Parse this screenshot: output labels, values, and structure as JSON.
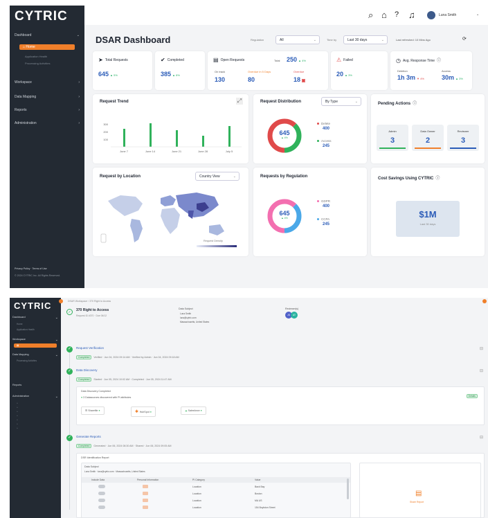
{
  "app": {
    "logo": "CYTRIC",
    "accent": "#f07f2a",
    "primary": "#2b5cb8",
    "success": "#30b25b"
  },
  "topbar": {
    "user_name": "Luna Smith",
    "icons": [
      "search-icon",
      "home-icon",
      "help-icon",
      "bell-icon"
    ]
  },
  "sidebar": {
    "items": [
      {
        "label": "Dashboard",
        "active_child": "Home",
        "children": [
          "Application Health",
          "Processing Activities"
        ]
      },
      {
        "label": "Workspace"
      },
      {
        "label": "Data Mapping"
      },
      {
        "label": "Reports"
      },
      {
        "label": "Administration"
      }
    ],
    "footer_links": "Privacy Policy  ·  Terms of Use",
    "copyright": "© 2024 CYTRIC Inc. All Rights Reserved."
  },
  "dashboard": {
    "title": "DSAR Dashboard",
    "filters": {
      "regulation_label": "Regulation",
      "regulation_value": "All",
      "timeby_label": "Time by",
      "timeby_value": "Last 30 days",
      "refresh_text": "Last refreshed: 10 Mins Ago"
    },
    "kpis": [
      {
        "title": "Total Requests",
        "value": "645",
        "delta": "▲ 5%",
        "icon": "send-icon"
      },
      {
        "title": "Completed",
        "value": "385",
        "delta": "▲ 8%",
        "icon": "check-badge-icon"
      },
      {
        "title": "Open Requests",
        "total_label": "Total",
        "total_value": "250",
        "delta": "▲ 4%",
        "icon": "document-icon",
        "subs": [
          {
            "label": "On track",
            "value": "130"
          },
          {
            "label": "Overdue in 5 Days",
            "value": "80"
          },
          {
            "label": "Overdue",
            "value": "18"
          }
        ]
      },
      {
        "title": "Failed",
        "value": "20",
        "delta": "▲ 3%",
        "icon": "warning-icon"
      },
      {
        "title": "Avg. Response Time",
        "icon": "clock-icon",
        "subs": [
          {
            "label": "Deletion",
            "value": "1h 3m",
            "delta": "▼ 4%"
          },
          {
            "label": "Access",
            "value": "30m",
            "delta": "▲ 3%"
          }
        ]
      }
    ],
    "request_trend": {
      "title": "Request Trend",
      "y_ticks": [
        "300",
        "200",
        "100"
      ],
      "x_labels": [
        "June 7",
        "June 14",
        "June 21",
        "June 28",
        "July 5"
      ]
    },
    "distribution": {
      "title": "Request Distribution",
      "select": "By Type",
      "center_value": "645",
      "center_delta": "▲ 4%",
      "legend": [
        {
          "label": "Delete",
          "value": "400",
          "color": "#e04a4a"
        },
        {
          "label": "Access",
          "value": "245",
          "color": "#30b25b"
        }
      ]
    },
    "pending": {
      "title": "Pending Actions",
      "tiles": [
        {
          "label": "Admin",
          "value": "3",
          "color": "#30b25b"
        },
        {
          "label": "Data Owner",
          "value": "2",
          "color": "#f07f2a"
        },
        {
          "label": "Reviewer",
          "value": "3",
          "color": "#2b5cb8"
        }
      ]
    },
    "location": {
      "title": "Request by Location",
      "select": "Country View",
      "legend_label": "Request Density"
    },
    "regulation": {
      "title": "Requests by Regulation",
      "center_value": "645",
      "center_delta": "▲ 4%",
      "legend": [
        {
          "label": "GDPR",
          "value": "400",
          "color": "#f36fb0"
        },
        {
          "label": "CCPA",
          "value": "245",
          "color": "#4aa8e8"
        }
      ]
    },
    "savings": {
      "title": "Cost Savings Using CYTRIC",
      "value": "$1M",
      "caption": "Last 30 days"
    }
  },
  "detail": {
    "breadcrumb": "DSAR Workspace  ›  370 Right to Access",
    "request_title": "370 Right to Access",
    "request_sub": "Request ID #370 · Due 06/12",
    "data_subject_label": "Data Subject",
    "data_subject_lines": [
      "Luna Smith",
      "luna@cytric.com",
      "Massachusetts, United States"
    ],
    "reviewers_label": "Reviewer(s)",
    "reviewer_initials": [
      "JS",
      "AT"
    ],
    "steps": [
      {
        "title": "Request Verification",
        "status": "Completed",
        "meta": "Verified  ·  Jun 04, 2024 09:14 AM  ·  Verified by Admin  ·  Jun 04, 2024 09:18 AM"
      },
      {
        "title": "Data Discovery",
        "status": "Completed",
        "meta": "Started  ·  Jun 05, 2024 10:02 AM  ·  Completed  ·  Jun 05, 2024 11:47 AM"
      },
      {
        "title": "Generate Reports",
        "status": "Completed",
        "meta": "Generated  ·  Jun 06, 2024 08:30 AM  ·  Shared  ·  Jun 06, 2024 09:05 AM"
      }
    ],
    "discovery": {
      "title": "Data Discovery Completed",
      "line": "3 Datasources discovered with PI attributes",
      "badge": "Details",
      "sources": [
        "Sharefile",
        "HubSpot",
        "Salesforce"
      ]
    },
    "report": {
      "title": "DSR Identification Report",
      "subject_label": "Data Subject",
      "subject_line": "Luna Smith  ·  luna@cytric.com  ·  Massachusetts, United States",
      "columns": [
        "Include Data",
        "Personal Information",
        "PI Category",
        "Value"
      ],
      "rows": [
        {
          "cat": "Location",
          "val": "Back Bay"
        },
        {
          "cat": "Location",
          "val": "Boston"
        },
        {
          "cat": "Location",
          "val": "MA US"
        },
        {
          "cat": "Location",
          "val": "154 Boylston Street"
        }
      ],
      "download_label": "Share Report"
    }
  }
}
